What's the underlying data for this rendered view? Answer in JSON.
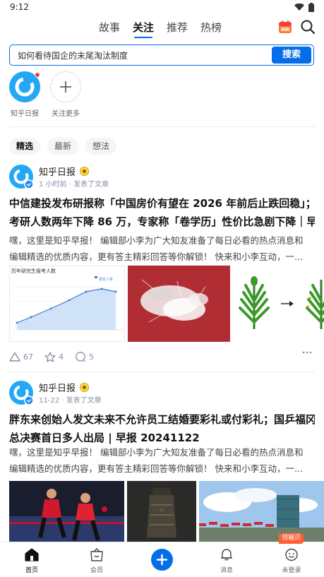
{
  "status": {
    "time": "9:12"
  },
  "nav": {
    "tabs": [
      "故事",
      "关注",
      "推荐",
      "热榜"
    ],
    "active_tab": "关注"
  },
  "search": {
    "query": "如何看待国企的末尾淘汰制度",
    "button": "搜索"
  },
  "follows": [
    {
      "name": "知乎日报",
      "has_new": true
    },
    {
      "name": "关注更多"
    }
  ],
  "filters": [
    "精选",
    "最新",
    "想法"
  ],
  "posts": [
    {
      "author": "知乎日报",
      "meta": "1 小时前 · 发表了文章",
      "title_line1": "中信建投发布研报称「中国房价有望在 2026 年前后止跌回稳」；",
      "title_line2": "考研人数两年下降 86 万，专家称「卷学历」性价比急剧下降｜早…",
      "excerpt_line1": "嘿，这里是知乎早报！ 编辑部小李为广大知友准备了每日必看的热点消息和",
      "excerpt_line2": "编辑精选的优质内容，更有答主精彩回答等你解锁！ 快来和小李互动，一…",
      "chart_caption": "历年研究生报考人数",
      "chart_legend": "报名人数",
      "likes": "67",
      "stars": "4",
      "comments": "5"
    },
    {
      "author": "知乎日报",
      "meta": "11-22 · 发表了文章",
      "title_line1": "胖东来创始人发文未来不允许员工结婚要彩礼或付彩礼；国乒福冈",
      "title_line2": "总决赛首日多人出局 | 早报 20241122",
      "excerpt_line1": "嘿，这里是知乎早报！ 编辑部小李为广大知友准备了每日必看的热点消息和",
      "excerpt_line2": "编辑精选的优质内容，更有答主精彩回答等你解锁！ 快来和小李互动，一…"
    }
  ],
  "bottom_nav": [
    "首页",
    "会员",
    "消息",
    "未登录"
  ],
  "welfare_badge": "领福贝",
  "colors": {
    "accent": "#056de8",
    "red": "#f1403c",
    "orange": "#ff5f35"
  }
}
